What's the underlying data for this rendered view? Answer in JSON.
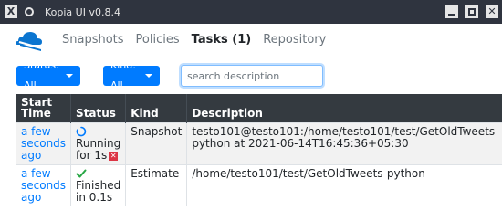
{
  "window": {
    "title": "Kopia UI v0.8.4"
  },
  "nav": {
    "items": [
      {
        "label": "Snapshots"
      },
      {
        "label": "Policies"
      },
      {
        "label": "Tasks (1)"
      },
      {
        "label": "Repository"
      }
    ],
    "active": "Tasks (1)"
  },
  "filters": {
    "status_label": "Status: All",
    "kind_label": "Kind: All",
    "search_placeholder": "search description"
  },
  "table": {
    "headers": [
      "Start Time",
      "Status",
      "Kind",
      "Description"
    ],
    "rows": [
      {
        "start": "a few seconds ago",
        "status_icon": "spinner-icon",
        "status": "Running for 1s",
        "kind": "Snapshot",
        "description": "testo101@testo101:/home/testo101/test/GetOldTweets-python at 2021-06-14T16:45:36+05:30"
      },
      {
        "start": "a few seconds ago",
        "status_icon": "checkmark-icon",
        "status": "Finished in 0.1s",
        "kind": "Estimate",
        "description": "/home/testo101/test/GetOldTweets-python"
      }
    ]
  },
  "colors": {
    "accent": "#007bff",
    "header_bg": "#343a40",
    "titlebar_bg": "#2f343f",
    "success": "#28a745",
    "danger": "#dc3545"
  }
}
